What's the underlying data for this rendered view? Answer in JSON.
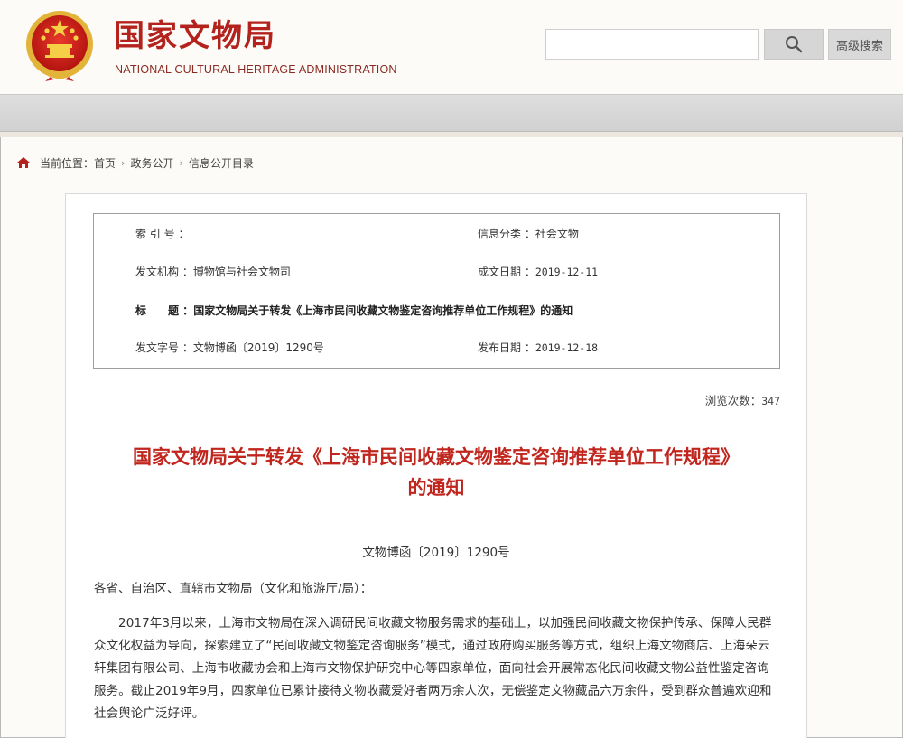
{
  "header": {
    "title": "国家文物局",
    "subtitle": "NATIONAL CULTURAL HERITAGE ADMINISTRATION",
    "search_placeholder": "",
    "search_icon": "magnifier-icon",
    "advanced_search_label": "高级搜索"
  },
  "breadcrumb": {
    "prefix": "当前位置：",
    "items": [
      "首页",
      "政务公开",
      "信息公开目录"
    ]
  },
  "meta": {
    "index_label": "索 引 号 ：",
    "index_value": "",
    "category_label": "信息分类 ：",
    "category_value": "社会文物",
    "issuer_label": "发文机构 ：",
    "issuer_value": "博物馆与社会文物司",
    "created_label": "成文日期 ：",
    "created_value": "2019-12-11",
    "title_label": "标　　题 ：",
    "title_value": "国家文物局关于转发《上海市民间收藏文物鉴定咨询推荐单位工作规程》的通知",
    "docno_label": "发文字号 ：",
    "docno_value": "文物博函〔2019〕1290号",
    "published_label": "发布日期 ：",
    "published_value": "2019-12-18"
  },
  "views": {
    "label": "浏览次数：",
    "count": "347"
  },
  "document": {
    "title_line1": "国家文物局关于转发《上海市民间收藏文物鉴定咨询推荐单位工作规程》",
    "title_line2": "的通知",
    "number": "文物博函〔2019〕1290号",
    "recipient": "各省、自治区、直辖市文物局（文化和旅游厅/局）：",
    "paragraph1": "2017年3月以来，上海市文物局在深入调研民间收藏文物服务需求的基础上，以加强民间收藏文物保护传承、保障人民群众文化权益为导向，探索建立了“民间收藏文物鉴定咨询服务”模式，通过政府购买服务等方式，组织上海文物商店、上海朵云轩集团有限公司、上海市收藏协会和上海市文物保护研究中心等四家单位，面向社会开展常态化民间收藏文物公益性鉴定咨询服务。截止2019年9月，四家单位已累计接待文物收藏爱好者两万余人次，无偿鉴定文物藏品六万余件，受到群众普遍欢迎和社会舆论广泛好评。"
  },
  "colors": {
    "brand_red": "#b3221c",
    "title_red": "#c0251e"
  }
}
